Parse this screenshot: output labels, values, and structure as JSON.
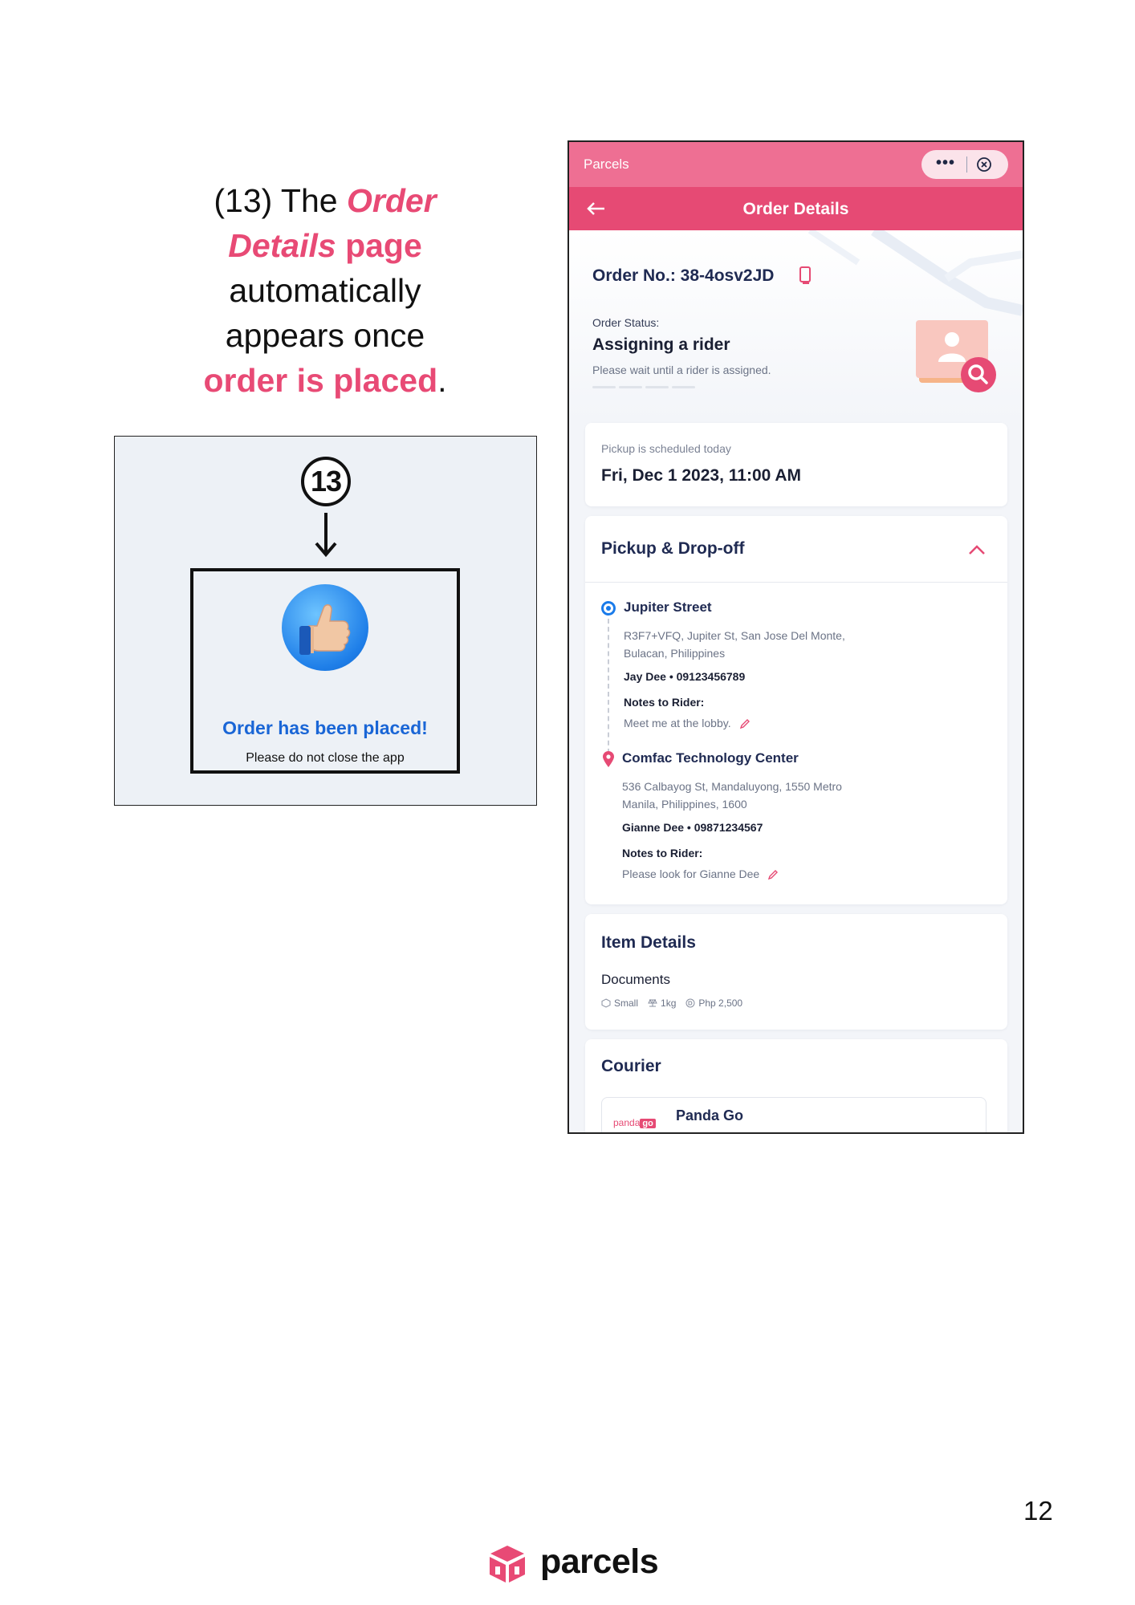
{
  "caption": {
    "prefix": "(13) The",
    "highlight_1": "Order Details",
    "highlight_2": "page",
    "line_3": "automatically",
    "line_4": "appears once",
    "highlight_3": "order is placed",
    "suffix": "."
  },
  "inset": {
    "step_number": "13",
    "confirm_title": "Order has been placed!",
    "confirm_subtitle": "Please do not close the app"
  },
  "app": {
    "topbar_title": "Parcels",
    "capsule_more": "•••",
    "nav_title": "Order Details",
    "order_number": "Order No.: 38-4osv2JD",
    "status_label": "Order Status:",
    "status_value": "Assigning a rider",
    "status_note": "Please wait until a rider is assigned.",
    "schedule_label": "Pickup is scheduled today",
    "schedule_value": "Fri, Dec 1 2023, 11:00 AM",
    "pickup_section_title": "Pickup & Drop-off",
    "pickup": {
      "name": "Jupiter Street",
      "address_line1": "R3F7+VFQ, Jupiter St, San Jose Del Monte,",
      "address_line2": "Bulacan, Philippines",
      "contact": "Jay Dee  •  09123456789",
      "notes_label": "Notes to Rider:",
      "notes": "Meet me at the lobby."
    },
    "dropoff": {
      "name": "Comfac Technology Center",
      "address_line1": "536 Calbayog St, Mandaluyong, 1550 Metro",
      "address_line2": "Manila, Philippines, 1600",
      "contact": "Gianne Dee  •  09871234567",
      "notes_label": "Notes to Rider:",
      "notes": "Please look for Gianne Dee"
    },
    "items_title": "Item Details",
    "item_type": "Documents",
    "item_size": "Small",
    "item_weight": "1kg",
    "item_value": "Php 2,500",
    "courier_title": "Courier",
    "courier_logo_text": "panda",
    "courier_logo_badge": "go",
    "courier_name": "Panda Go"
  },
  "footer": {
    "page_number": "12",
    "brand_name": "parcels"
  },
  "colors": {
    "brand_pink": "#e84a75",
    "confirm_blue": "#1a66d6",
    "navy": "#1f2a52"
  }
}
